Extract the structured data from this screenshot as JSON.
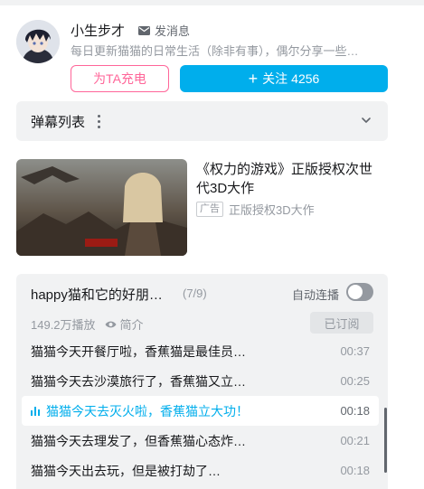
{
  "uploader": {
    "name": "小生步才",
    "message_label": "发消息",
    "description": "每日更新猫猫的日常生活（除非有事），偶尔分享一些…",
    "charge_label": "为TA充电",
    "follow_label": "关注",
    "follow_count": "4256"
  },
  "danmaku": {
    "title": "弹幕列表"
  },
  "ad": {
    "title": "《权力的游戏》正版授权次世代3D大作",
    "badge": "广告",
    "subtitle": "正版授权3D大作"
  },
  "playlist": {
    "title": "happy猫和它的好朋…",
    "progress": "(7/9)",
    "autoplay_label": "自动连播",
    "autoplay_on": false,
    "plays": "149.2万播放",
    "intro_label": "简介",
    "subscribed_label": "已订阅",
    "items": [
      {
        "title": "猫猫今天开餐厅啦，香蕉猫是最佳员…",
        "duration": "00:37",
        "active": false
      },
      {
        "title": "猫猫今天去沙漠旅行了，香蕉猫又立…",
        "duration": "00:25",
        "active": false
      },
      {
        "title": "猫猫今天去灭火啦，香蕉猫立大功！",
        "duration": "00:18",
        "active": true
      },
      {
        "title": "猫猫今天去理发了，但香蕉猫心态炸…",
        "duration": "00:21",
        "active": false
      },
      {
        "title": "猫猫今天出去玩，但是被打劫了…",
        "duration": "00:18",
        "active": false
      }
    ]
  },
  "colors": {
    "accent": "#00aeec",
    "pink": "#ff6699",
    "panel": "#f1f2f3"
  },
  "icons": [
    "mail-icon",
    "plus-icon",
    "more-icon",
    "chevron-down-icon",
    "eye-icon",
    "playing-icon"
  ]
}
